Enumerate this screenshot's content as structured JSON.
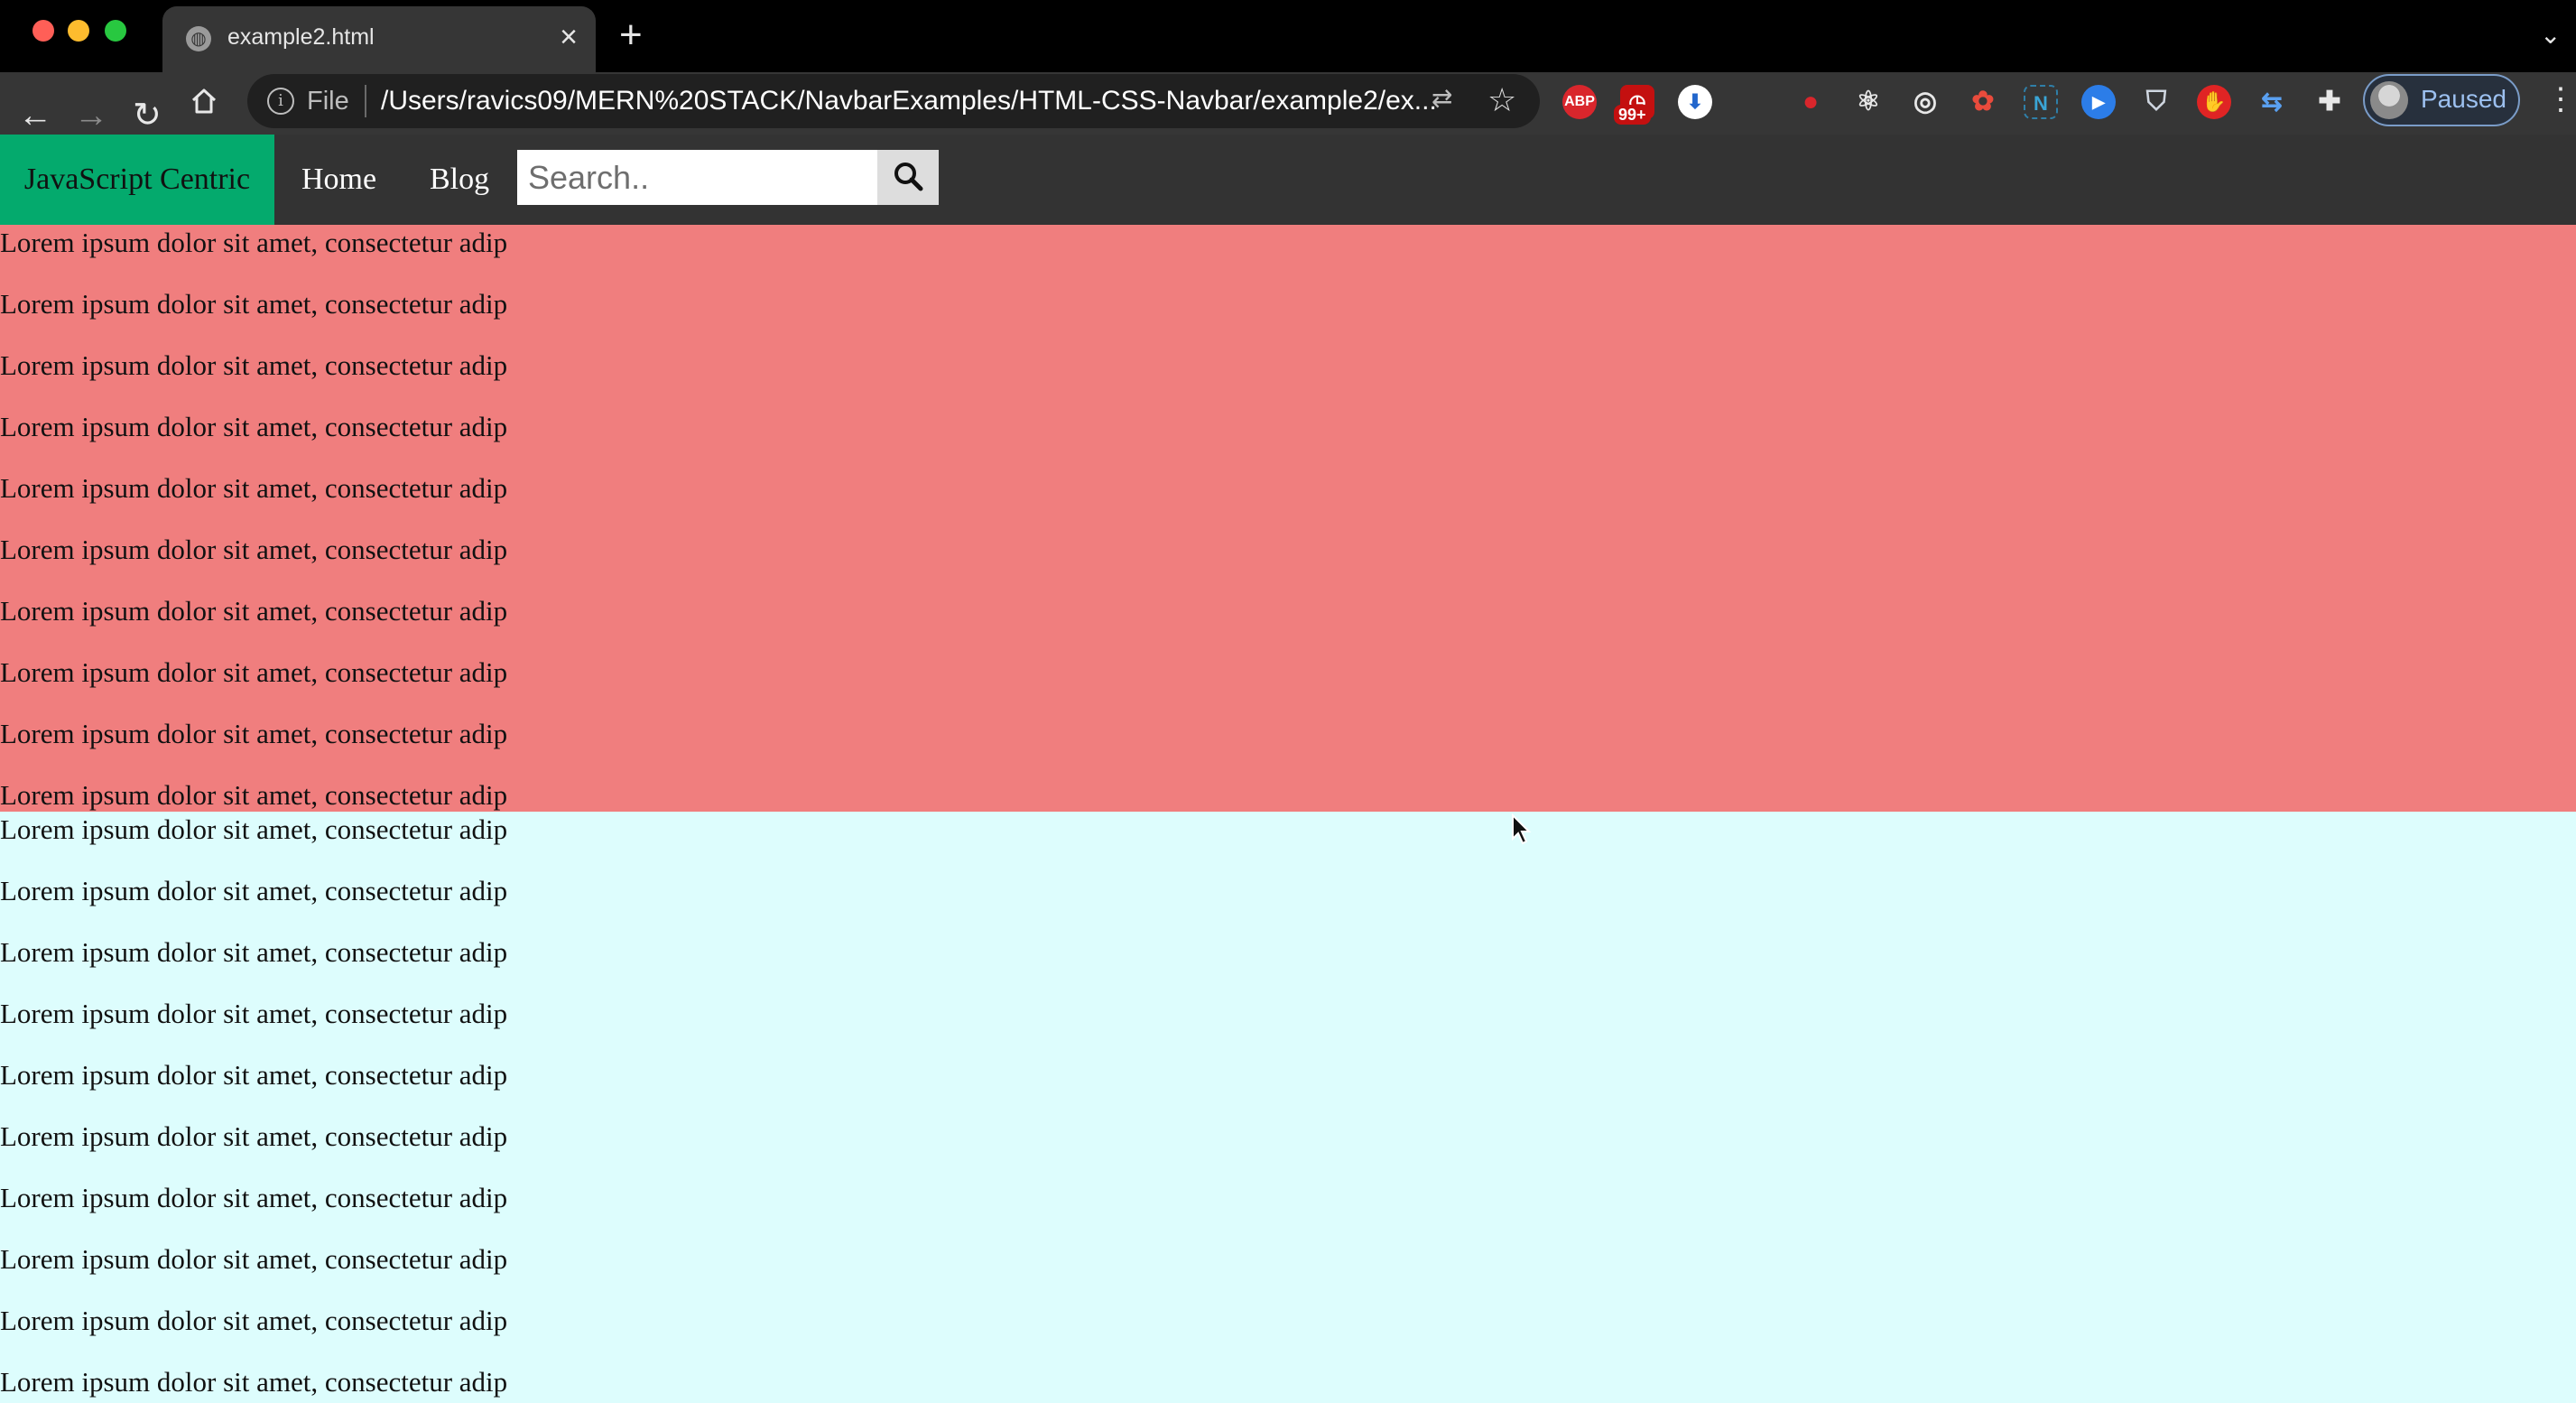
{
  "browser": {
    "tab_title": "example2.html",
    "omnibox": {
      "scheme": "File",
      "url": "/Users/ravics09/MERN%20STACK/NavbarExamples/HTML-CSS-Navbar/example2/ex..."
    },
    "extensions": [
      {
        "name": "adblock",
        "label": "ABP",
        "color": "#d9262c"
      },
      {
        "name": "notifications",
        "label": "",
        "badge": "99+",
        "color": "#c41010"
      },
      {
        "name": "downloader",
        "label": "",
        "color": "#f2b705"
      },
      {
        "name": "record",
        "label": "",
        "color": "#d9262c"
      },
      {
        "name": "react-devtools",
        "label": "",
        "color": "#e8e8e8"
      },
      {
        "name": "target",
        "label": "",
        "color": "#e8e8e8"
      },
      {
        "name": "color-picker",
        "label": "",
        "color": "#e94b3c"
      },
      {
        "name": "n-extension",
        "label": "N",
        "color": "#2f7fa8"
      },
      {
        "name": "player",
        "label": "",
        "color": "#2c7de8"
      },
      {
        "name": "shield",
        "label": "",
        "color": "#cfd6e0"
      },
      {
        "name": "stop-hand",
        "label": "",
        "color": "#e02424"
      },
      {
        "name": "arrows",
        "label": "",
        "color": "#5aa0f0"
      },
      {
        "name": "puzzle",
        "label": "",
        "color": "#e8e8e8"
      }
    ],
    "profile_status": "Paused"
  },
  "page": {
    "brand": "JavaScript Centric",
    "nav_links": [
      "Home",
      "Blog"
    ],
    "search_placeholder": "Search..",
    "colors": {
      "brand": "#04aa6d",
      "navbar": "#333333",
      "section_red": "#f07e7e",
      "section_cyan": "#ddfdfd"
    },
    "red_section_lines": [
      "Lorem ipsum dolor sit amet, consectetur adip",
      "Lorem ipsum dolor sit amet, consectetur adip",
      "Lorem ipsum dolor sit amet, consectetur adip",
      "Lorem ipsum dolor sit amet, consectetur adip",
      "Lorem ipsum dolor sit amet, consectetur adip",
      "Lorem ipsum dolor sit amet, consectetur adip",
      "Lorem ipsum dolor sit amet, consectetur adip",
      "Lorem ipsum dolor sit amet, consectetur adip",
      "Lorem ipsum dolor sit amet, consectetur adip",
      "Lorem ipsum dolor sit amet, consectetur adip"
    ],
    "cyan_section_lines": [
      "Lorem ipsum dolor sit amet, consectetur adip",
      "Lorem ipsum dolor sit amet, consectetur adip",
      "Lorem ipsum dolor sit amet, consectetur adip",
      "Lorem ipsum dolor sit amet, consectetur adip",
      "Lorem ipsum dolor sit amet, consectetur adip",
      "Lorem ipsum dolor sit amet, consectetur adip",
      "Lorem ipsum dolor sit amet, consectetur adip",
      "Lorem ipsum dolor sit amet, consectetur adip",
      "Lorem ipsum dolor sit amet, consectetur adip",
      "Lorem ipsum dolor sit amet, consectetur adip"
    ]
  }
}
